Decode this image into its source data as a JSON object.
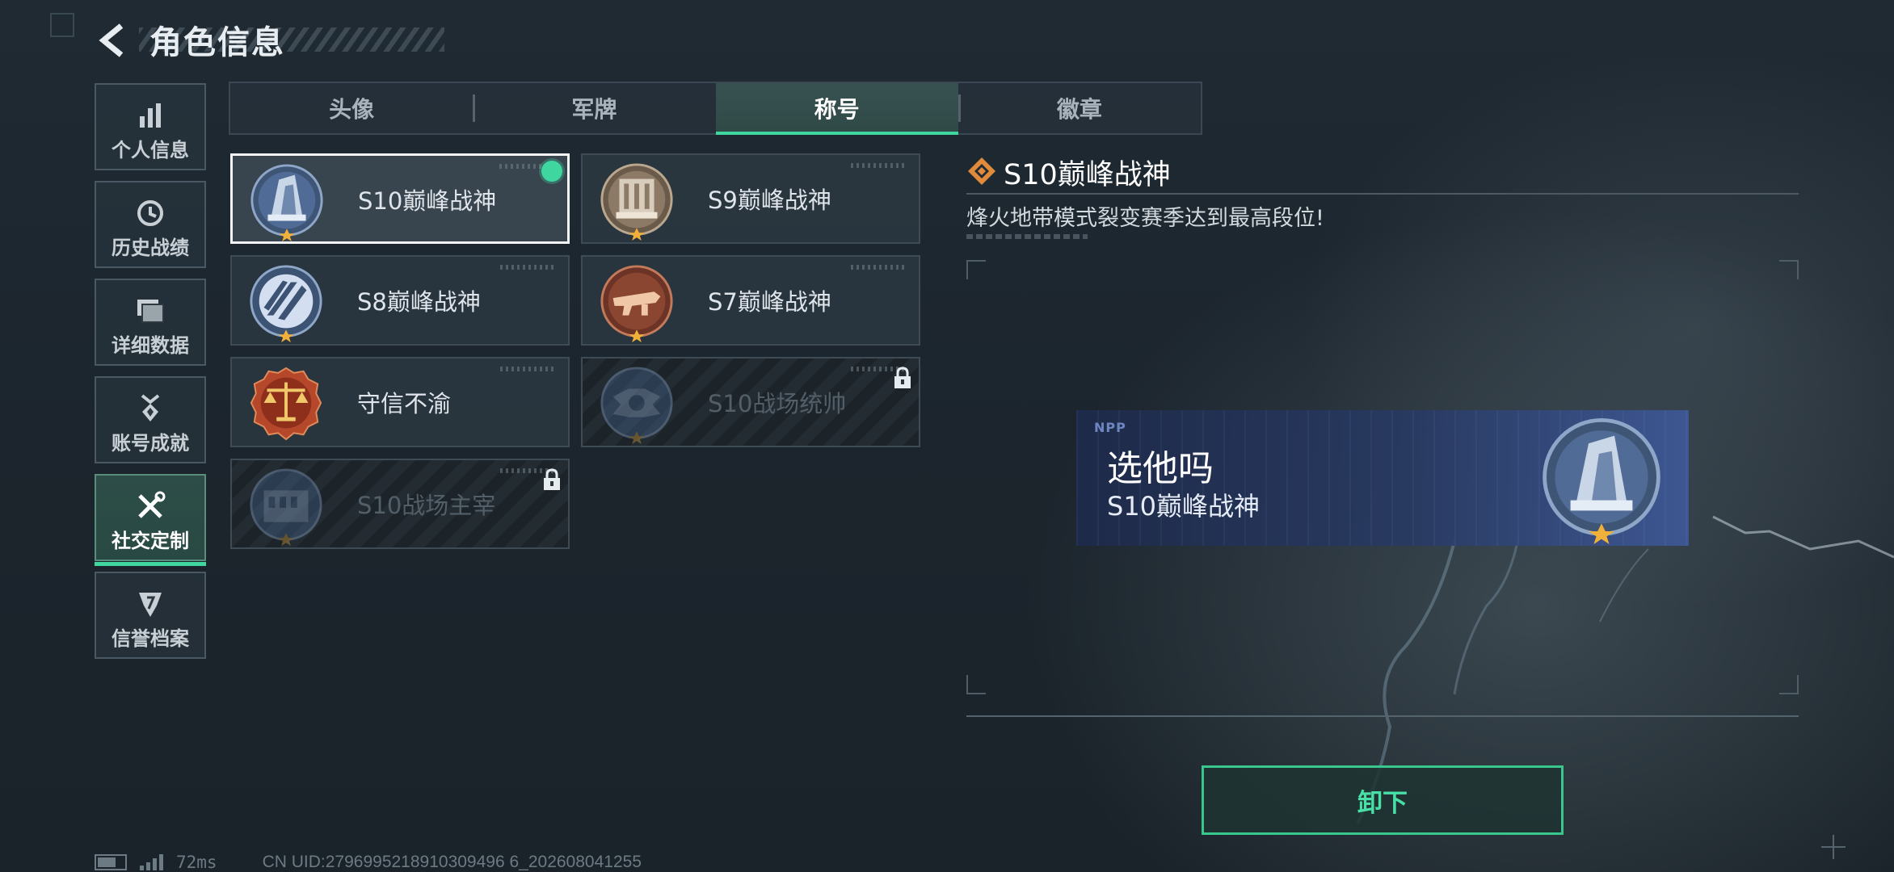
{
  "header": {
    "title": "角色信息"
  },
  "sidebar": {
    "items": [
      {
        "label": "个人信息",
        "icon": "bar-chart-icon"
      },
      {
        "label": "历史战绩",
        "icon": "history-clock-icon"
      },
      {
        "label": "详细数据",
        "icon": "folder-icon"
      },
      {
        "label": "账号成就",
        "icon": "medal-icon"
      },
      {
        "label": "社交定制",
        "icon": "wrench-screwdriver-icon",
        "active": true
      },
      {
        "label": "信誉档案",
        "icon": "shield-badge-icon"
      }
    ]
  },
  "tabs": [
    {
      "label": "头像"
    },
    {
      "label": "军牌"
    },
    {
      "label": "称号",
      "active": true
    },
    {
      "label": "徽章"
    }
  ],
  "titles": [
    {
      "name": "S10巅峰战神",
      "emblem": "s10-peak-emblem",
      "selected": true,
      "equipped": true,
      "locked": false
    },
    {
      "name": "S9巅峰战神",
      "emblem": "s9-peak-emblem",
      "selected": false,
      "locked": false
    },
    {
      "name": "S8巅峰战神",
      "emblem": "s8-peak-emblem",
      "selected": false,
      "locked": false
    },
    {
      "name": "S7巅峰战神",
      "emblem": "s7-peak-emblem",
      "selected": false,
      "locked": false
    },
    {
      "name": "守信不渝",
      "emblem": "scales-emblem",
      "selected": false,
      "locked": false
    },
    {
      "name": "S10战场统帅",
      "emblem": "s10-commander-emblem",
      "selected": false,
      "locked": true
    },
    {
      "name": "S10战场主宰",
      "emblem": "s10-dominator-emblem",
      "selected": false,
      "locked": true
    }
  ],
  "detail": {
    "title": "S10巅峰战神",
    "description": "烽火地带模式裂变赛季达到最高段位!"
  },
  "preview": {
    "player_name": "选他吗",
    "title": "S10巅峰战神",
    "logo": "NPP"
  },
  "actions": {
    "unequip_label": "卸下"
  },
  "status": {
    "ping": "72ms",
    "uid": "CN UID:2796995218910309496 6_202608041255"
  },
  "colors": {
    "accent": "#3fd6a0",
    "tab_active": "#466e64",
    "banner": "#2a3a66",
    "diamond": "#e08a3c"
  }
}
